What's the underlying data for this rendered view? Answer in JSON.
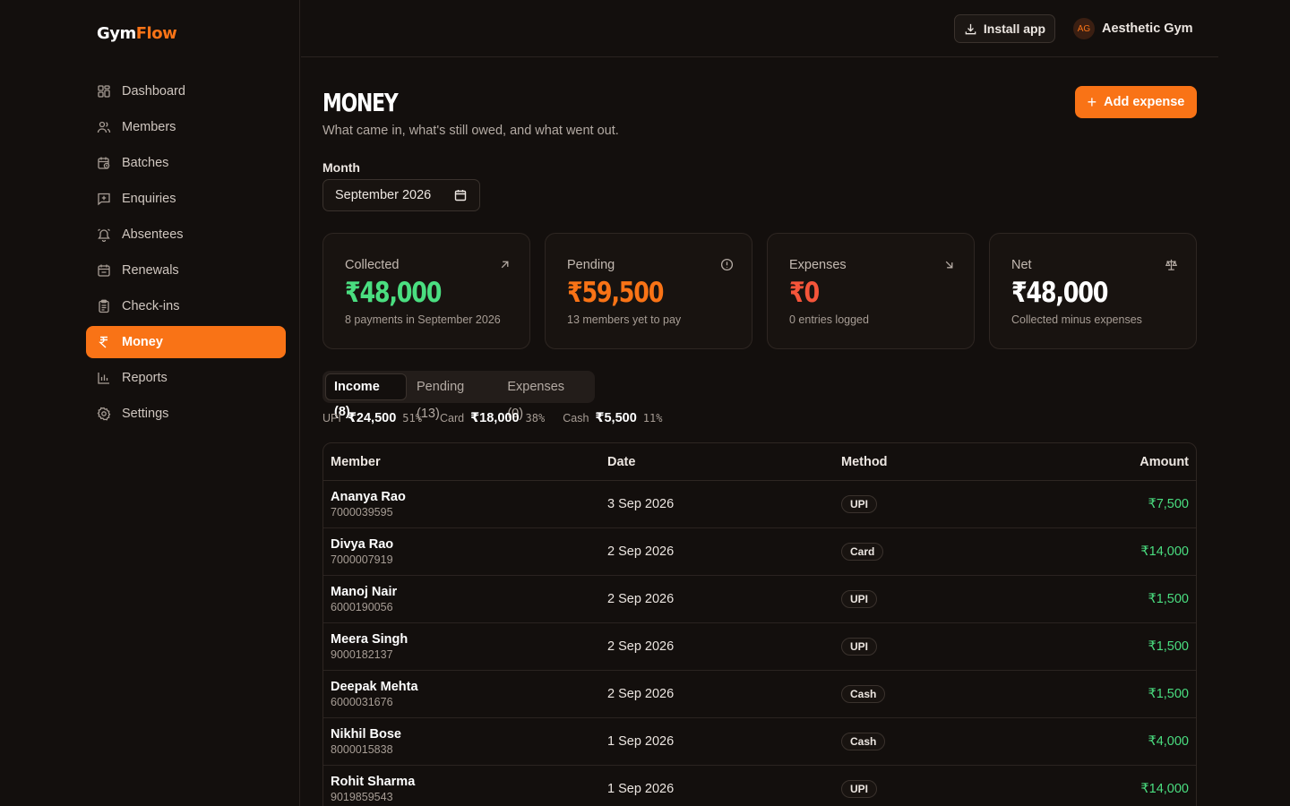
{
  "brand": {
    "part1": "Gym",
    "part2": "Flow"
  },
  "nav": [
    {
      "label": "Dashboard",
      "icon": "dashboard-icon"
    },
    {
      "label": "Members",
      "icon": "users-icon"
    },
    {
      "label": "Batches",
      "icon": "calendar-clock-icon"
    },
    {
      "label": "Enquiries",
      "icon": "message-plus-icon"
    },
    {
      "label": "Absentees",
      "icon": "bell-off-icon"
    },
    {
      "label": "Renewals",
      "icon": "calendar-check-icon"
    },
    {
      "label": "Check-ins",
      "icon": "clipboard-icon"
    },
    {
      "label": "Money",
      "icon": "rupee-icon",
      "active": true
    },
    {
      "label": "Reports",
      "icon": "bar-chart-icon"
    },
    {
      "label": "Settings",
      "icon": "gear-icon"
    }
  ],
  "header": {
    "install_label": "Install app",
    "avatar_initials": "AG",
    "account_name": "Aesthetic Gym"
  },
  "page": {
    "title": "MONEY",
    "subtitle": "What came in, what's still owed, and what went out.",
    "add_button": "Add expense",
    "month_label": "Month",
    "month_value": "September 2026"
  },
  "cards": {
    "collected": {
      "label": "Collected",
      "value": "₹48,000",
      "sub": "8 payments in September 2026",
      "icon": "arrow-up-right-icon"
    },
    "pending": {
      "label": "Pending",
      "value": "₹59,500",
      "sub": "13 members yet to pay",
      "icon": "alert-circle-icon"
    },
    "expenses": {
      "label": "Expenses",
      "value": "₹0",
      "sub": "0 entries logged",
      "icon": "arrow-down-right-icon"
    },
    "net": {
      "label": "Net",
      "value": "₹48,000",
      "sub": "Collected minus expenses",
      "icon": "scale-icon"
    }
  },
  "tabs": [
    {
      "label": "Income (8)",
      "active": true
    },
    {
      "label": "Pending (13)"
    },
    {
      "label": "Expenses (0)"
    }
  ],
  "breakdown": [
    {
      "method": "UPI",
      "amount": "₹24,500",
      "pct": "51%"
    },
    {
      "method": "Card",
      "amount": "₹18,000",
      "pct": "38%"
    },
    {
      "method": "Cash",
      "amount": "₹5,500",
      "pct": "11%"
    }
  ],
  "table": {
    "headers": {
      "member": "Member",
      "date": "Date",
      "method": "Method",
      "amount": "Amount"
    },
    "rows": [
      {
        "name": "Ananya Rao",
        "phone": "7000039595",
        "date": "3 Sep 2026",
        "method": "UPI",
        "amount": "₹7,500"
      },
      {
        "name": "Divya Rao",
        "phone": "7000007919",
        "date": "2 Sep 2026",
        "method": "Card",
        "amount": "₹14,000"
      },
      {
        "name": "Manoj Nair",
        "phone": "6000190056",
        "date": "2 Sep 2026",
        "method": "UPI",
        "amount": "₹1,500"
      },
      {
        "name": "Meera Singh",
        "phone": "9000182137",
        "date": "2 Sep 2026",
        "method": "UPI",
        "amount": "₹1,500"
      },
      {
        "name": "Deepak Mehta",
        "phone": "6000031676",
        "date": "2 Sep 2026",
        "method": "Cash",
        "amount": "₹1,500"
      },
      {
        "name": "Nikhil Bose",
        "phone": "8000015838",
        "date": "1 Sep 2026",
        "method": "Cash",
        "amount": "₹4,000"
      },
      {
        "name": "Rohit Sharma",
        "phone": "9019859543",
        "date": "1 Sep 2026",
        "method": "UPI",
        "amount": "₹14,000"
      }
    ]
  },
  "colors": {
    "accent": "#f97316",
    "positive": "#4ade80",
    "negative": "#f5553a",
    "background": "#130f0d"
  }
}
